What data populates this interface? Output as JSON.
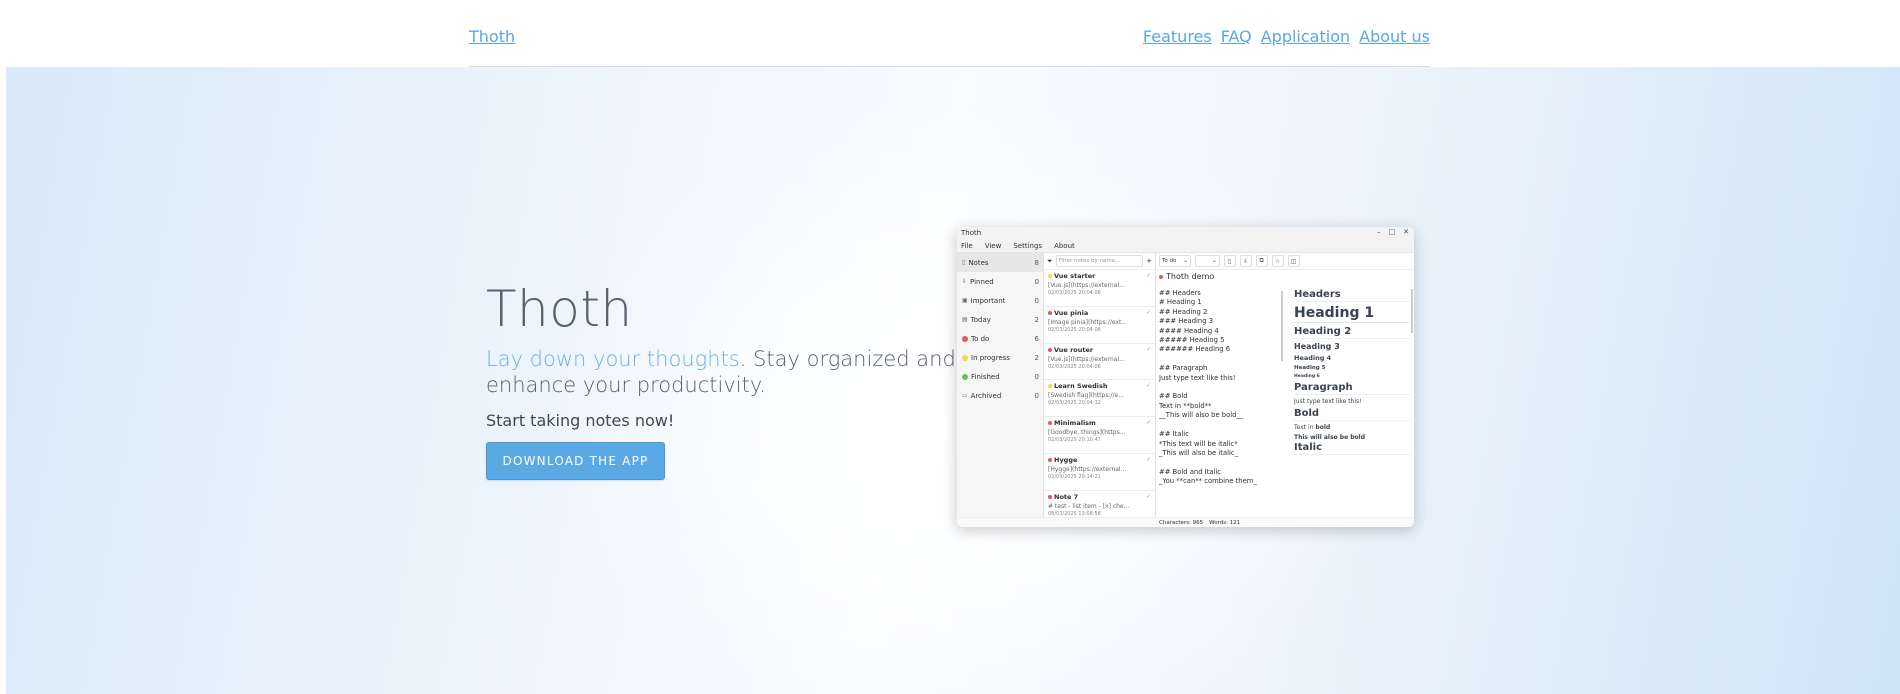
{
  "nav": {
    "brand": "Thoth",
    "links": [
      "Features",
      "FAQ",
      "Application",
      "About us"
    ]
  },
  "hero": {
    "title": "Thoth",
    "tagline_accent": "Lay down your thoughts",
    "tagline_rest": ". Stay organized and enhance your productivity.",
    "cta_text": "Start taking notes now!",
    "download_button": "DOWNLOAD THE APP"
  },
  "app": {
    "window_title": "Thoth",
    "window_controls": [
      "–",
      "□",
      "✕"
    ],
    "menu": [
      "File",
      "View",
      "Settings",
      "About"
    ],
    "sidebar": [
      {
        "label": "Notes",
        "count": "8",
        "icon": "note-icon"
      },
      {
        "label": "Pinned",
        "count": "0",
        "icon": "pin-icon"
      },
      {
        "label": "Important",
        "count": "0",
        "icon": "important-icon"
      },
      {
        "label": "Today",
        "count": "2",
        "icon": "calendar-icon"
      },
      {
        "label": "To do",
        "count": "6",
        "color": "#e05a5a"
      },
      {
        "label": "In progress",
        "count": "2",
        "color": "#f0d94a"
      },
      {
        "label": "Finished",
        "count": "0",
        "color": "#6cbf5f"
      },
      {
        "label": "Archived",
        "count": "0",
        "icon": "archive-icon"
      }
    ],
    "filter_placeholder": "Filter notes by name...",
    "add_label": "+",
    "notes": [
      {
        "title": "Vue starter",
        "preview": "[Vue.js](https://external...",
        "date": "02/03/2025 20:04:06",
        "color": "#f0d94a"
      },
      {
        "title": "Vue pinia",
        "preview": "[Image pinia](https://ext...",
        "date": "02/03/2025 20:04:06",
        "color": "#e05a5a"
      },
      {
        "title": "Vue router",
        "preview": "[Vue.js](https://external...",
        "date": "02/03/2025 20:04:06",
        "color": "#e05a5a"
      },
      {
        "title": "Learn Swedish",
        "preview": "[Swedish flag](https://e...",
        "date": "02/03/2025 20:04:32",
        "color": "#f0d94a"
      },
      {
        "title": "Minimalism",
        "preview": "[Goodbye, things](https...",
        "date": "02/03/2025 20:10:47",
        "color": "#e05a5a"
      },
      {
        "title": "Hygge",
        "preview": "[Hygge](https://external...",
        "date": "02/03/2025 20:14:21",
        "color": "#e05a5a"
      },
      {
        "title": "Note 7",
        "preview": "# test - list item - [x] che...",
        "date": "08/03/2025 13:08:58",
        "color": "#e05a5a"
      }
    ],
    "status_select": "To do",
    "note_title": "Thoth demo",
    "markdown": "## Headers\n# Heading 1\n## Heading 2\n### Heading 3\n#### Heading 4\n##### Heading 5\n###### Heading 6\n\n## Paragraph\nJust type text like this!\n\n## Bold\nText in **bold**\n__This will also be bold__\n\n## Italic\n*This text will be italic*\n_This will also be italic_\n\n## Bold and Italic\n_You **can** combine them_\n\n## Strikethrough",
    "preview": {
      "headers": "Headers",
      "h1": "Heading 1",
      "h2": "Heading 2",
      "h3": "Heading 3",
      "h4": "Heading 4",
      "h5": "Heading 5",
      "h6": "Heading 6",
      "paragraph": "Paragraph",
      "paragraph_text": "Just type text like this!",
      "bold": "Bold",
      "bold_text_pre": "Text in ",
      "bold_text_bold": "bold",
      "bold_text2": "This will also be bold",
      "italic": "Italic"
    },
    "status_bar": {
      "characters": "Characters: 965",
      "words": "Words: 121"
    }
  }
}
